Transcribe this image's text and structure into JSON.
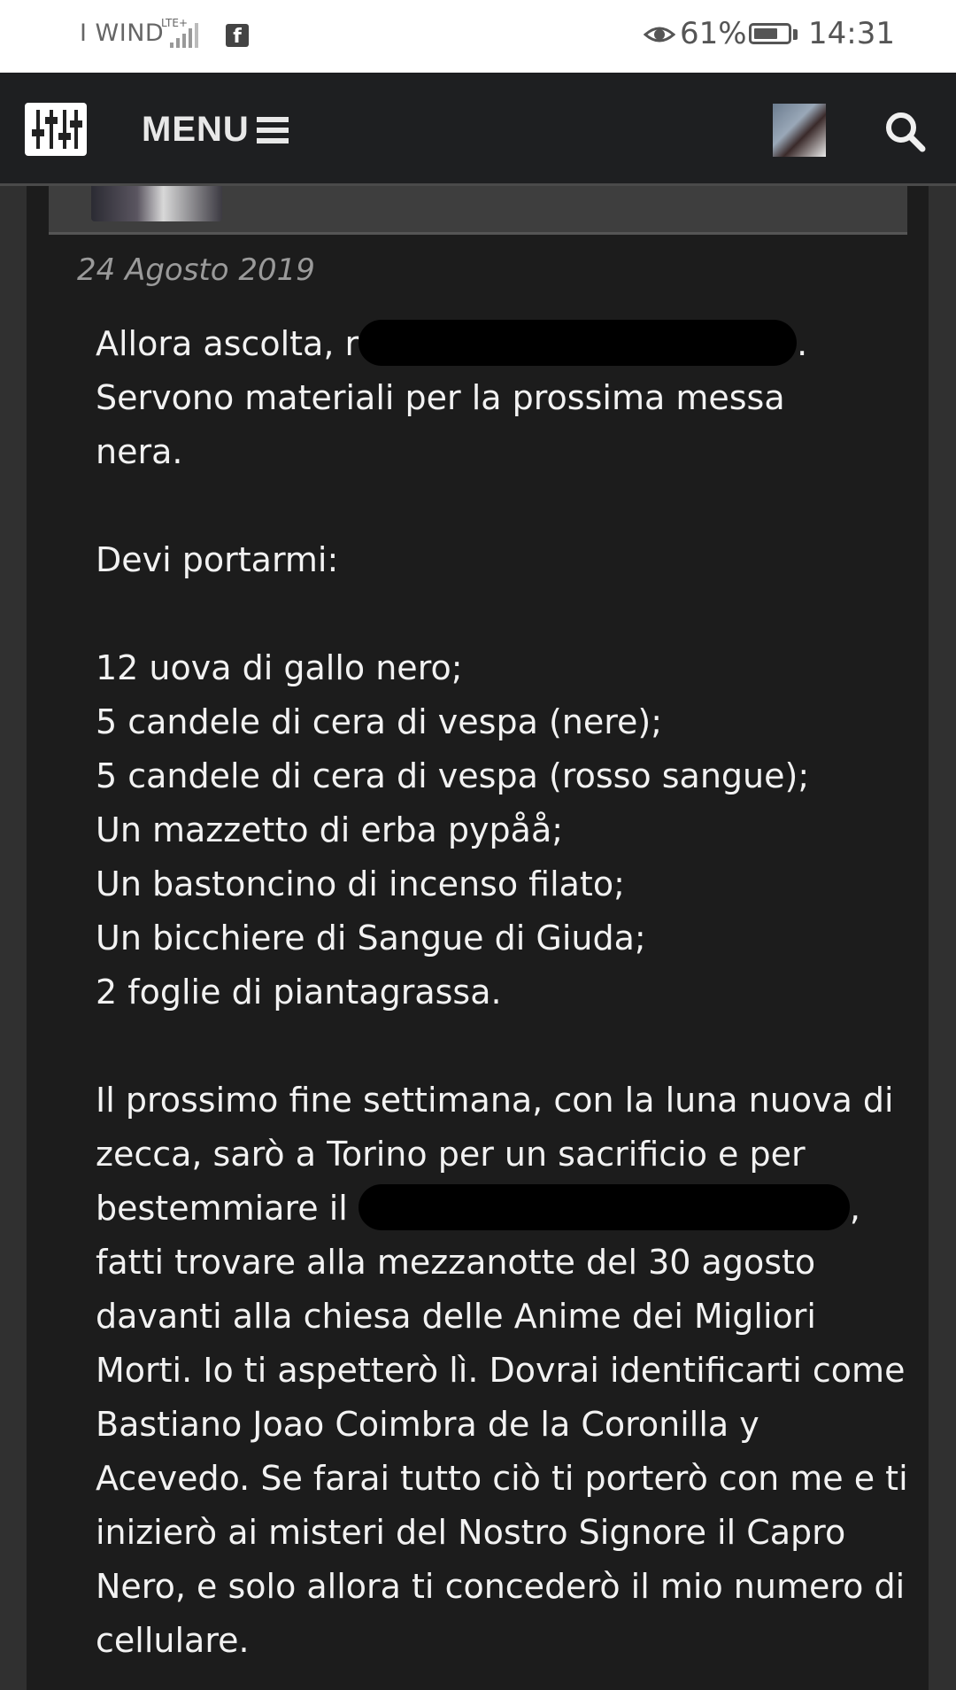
{
  "status_bar": {
    "carrier": "I WIND",
    "network": "LTE+",
    "battery": "61%",
    "time": "14:31"
  },
  "navbar": {
    "menu_label": "MENU"
  },
  "post": {
    "date": "24 Agosto 2019",
    "line1_prefix": "Allora ascolta, r",
    "line1_suffix": ".",
    "line2": "Servono materiali per la prossima messa nera.",
    "line3": "Devi portarmi:",
    "items": [
      "12 uova di gallo nero;",
      "5 candele di cera di vespa (nere);",
      "5 candele di cera di vespa (rosso sangue);",
      "Un mazzetto di erba pypåå;",
      "Un bastoncino di incenso filato;",
      "Un bicchiere di Sangue di Giuda;",
      "2 foglie di piantagrassa."
    ],
    "para_a": "Il prossimo fine settimana, con la luna nuova di zecca, sarò a Torino per un sacrificio e per bestemmiare il",
    "para_a_suffix": ",",
    "para_b": "fatti trovare alla mezzanotte del 30 agosto davanti alla chiesa delle Anime dei Migliori Morti. Io ti aspetterò lì. Dovrai identificarti come Bastiano Joao Coimbra de la Coronilla y Acevedo. Se farai tutto ciò ti porterò con me e ti inizierò ai misteri del Nostro Signore il Capro Nero, e solo allora ti concederò il mio numero di cellulare."
  },
  "icons": {
    "logo": "equalizer-sliders-icon",
    "menu": "hamburger-icon",
    "search": "search-icon",
    "eye": "eye-icon",
    "battery": "battery-icon",
    "signal": "signal-icon",
    "facebook": "facebook-icon"
  }
}
